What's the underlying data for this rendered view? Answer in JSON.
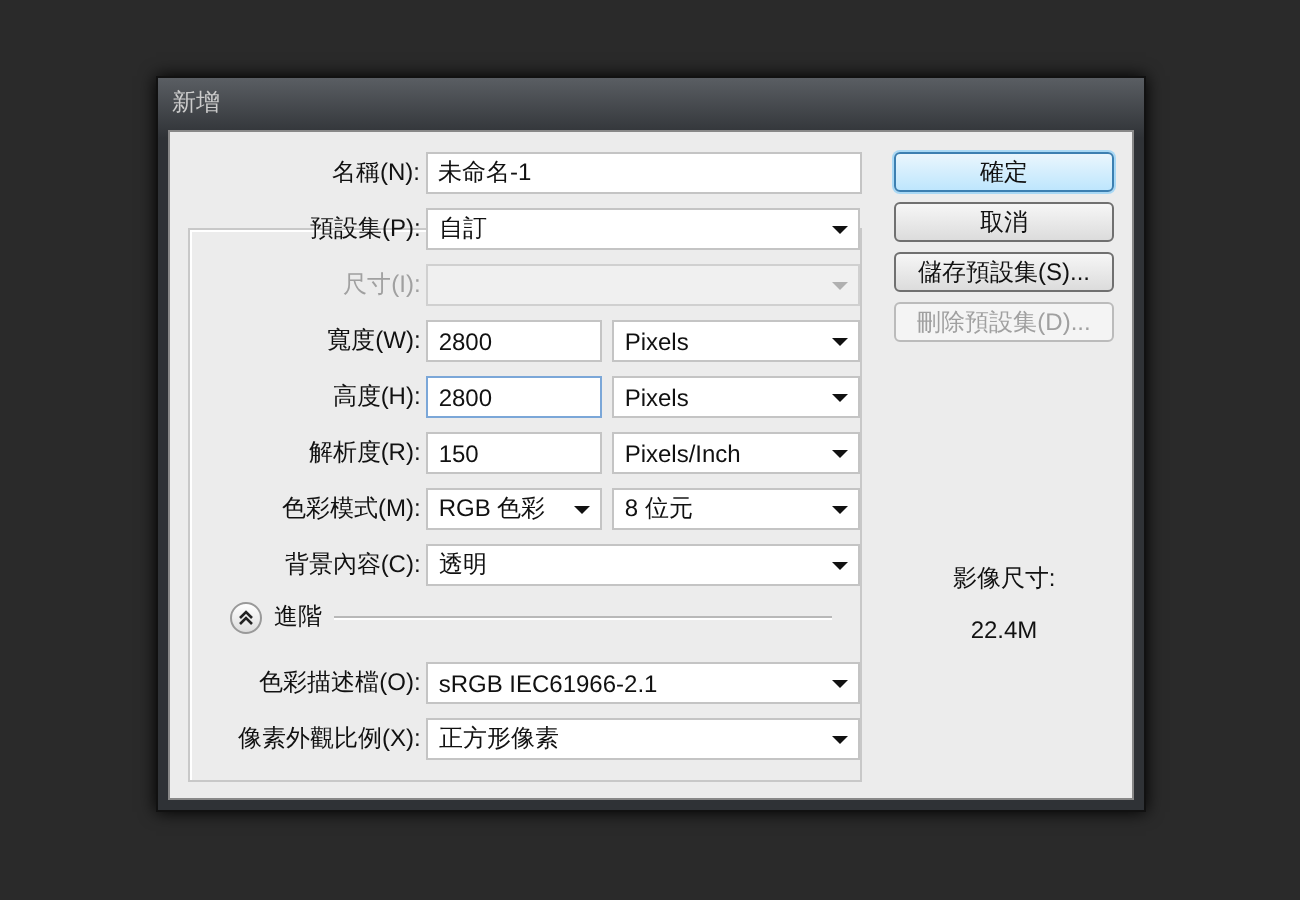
{
  "window": {
    "title": "新增"
  },
  "name_row": {
    "label": "名稱(N):",
    "controls": [
      {
        "kind": "input",
        "value": "未命名-1",
        "focused": false
      }
    ]
  },
  "preset_row": {
    "label": "預設集(P):",
    "controls": [
      {
        "kind": "select",
        "value": "自訂",
        "disabled": false
      }
    ]
  },
  "rows": [
    {
      "label": "尺寸(I):",
      "disabled": true,
      "controls": [
        {
          "kind": "select",
          "disabled": true
        }
      ]
    },
    {
      "label": "寬度(W):",
      "disabled": false,
      "controls": [
        {
          "kind": "input",
          "value": "2800",
          "focused": false
        },
        {
          "kind": "select",
          "value": "Pixels",
          "disabled": false
        }
      ]
    },
    {
      "label": "高度(H):",
      "disabled": false,
      "controls": [
        {
          "kind": "input",
          "value": "2800",
          "focused": true
        },
        {
          "kind": "select",
          "value": "Pixels",
          "disabled": false
        }
      ]
    },
    {
      "label": "解析度(R):",
      "disabled": false,
      "controls": [
        {
          "kind": "input",
          "value": "150",
          "focused": false
        },
        {
          "kind": "select",
          "value": "Pixels/Inch",
          "disabled": false
        }
      ]
    },
    {
      "label": "色彩模式(M):",
      "disabled": false,
      "controls": [
        {
          "kind": "select",
          "value": "RGB 色彩",
          "disabled": false
        },
        {
          "kind": "select",
          "value": "8 位元",
          "disabled": false
        }
      ]
    },
    {
      "label": "背景內容(C):",
      "disabled": false,
      "controls": [
        {
          "kind": "select",
          "value": "透明",
          "disabled": false
        }
      ]
    }
  ],
  "advanced": {
    "label": "進階",
    "expanded": true,
    "rows": [
      {
        "label": "色彩描述檔(O):",
        "disabled": false,
        "controls": [
          {
            "kind": "select",
            "value": "sRGB IEC61966-2.1",
            "disabled": false
          }
        ]
      },
      {
        "label": "像素外觀比例(X):",
        "disabled": false,
        "controls": [
          {
            "kind": "select",
            "value": "正方形像素",
            "disabled": false
          }
        ]
      }
    ]
  },
  "buttons": [
    {
      "label": "確定",
      "default": true,
      "disabled": false
    },
    {
      "label": "取消",
      "default": false,
      "disabled": false
    },
    {
      "label": "儲存預設集(S)...",
      "default": false,
      "disabled": false
    },
    {
      "label": "刪除預設集(D)...",
      "default": false,
      "disabled": true
    }
  ],
  "image_size": {
    "label": "影像尺寸:",
    "value": "22.4M"
  }
}
